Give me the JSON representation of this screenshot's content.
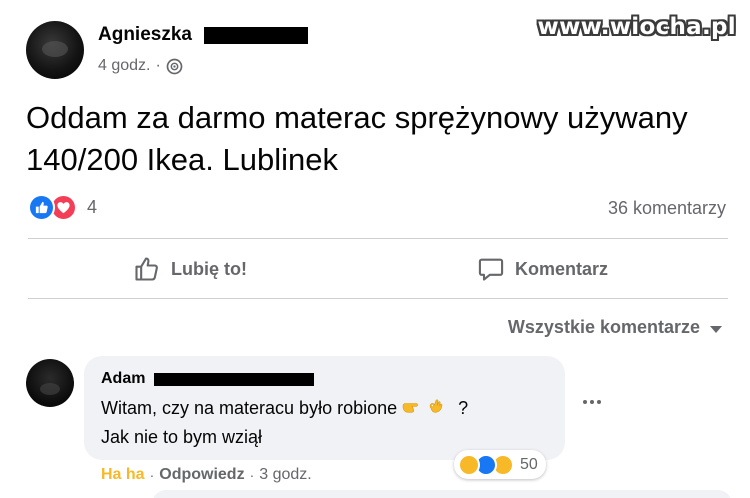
{
  "watermark": "www.wiocha.pl",
  "post": {
    "author": "Agnieszka",
    "time": "4 godz.",
    "privacy_icon": "globe-icon",
    "text": "Oddam za darmo materac sprężynowy używany 140/200 Ikea. Lublinek",
    "reaction_count": "4",
    "reaction_icons": [
      "like-icon",
      "love-icon"
    ],
    "comment_count": "36 komentarzy"
  },
  "actions": {
    "like_label": "Lubię to!",
    "comment_label": "Komentarz"
  },
  "comments_sort": {
    "label": "Wszystkie komentarze"
  },
  "comment": {
    "author": "Adam",
    "line1": "Witam, czy na materacu było robione",
    "line1_suffix": "?",
    "line2": "Jak nie to bym wziął",
    "haha_label": "Ha ha",
    "reply_label": "Odpowiedz",
    "time": "3 godz.",
    "reaction_count": "50",
    "reaction_icons": [
      "haha-icon",
      "like-icon",
      "wow-icon"
    ],
    "emoji": [
      "point-right-emoji",
      "ok-hand-emoji"
    ]
  },
  "colors": {
    "facebook_blue": "#1877f2",
    "love_red": "#f33e58",
    "haha_yellow": "#f7b928",
    "secondary_text": "#65676b",
    "bubble_bg": "#f0f2f5"
  }
}
